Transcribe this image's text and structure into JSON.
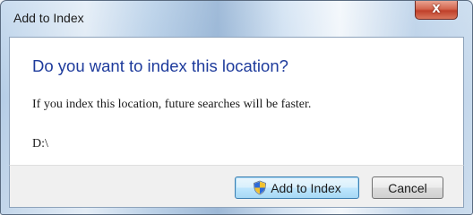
{
  "window": {
    "title": "Add to Index",
    "close_glyph": "X"
  },
  "dialog": {
    "heading": "Do you want to index this location?",
    "message": "If you index this location, future searches will be faster.",
    "location": "D:\\"
  },
  "buttons": {
    "primary_label": "Add to Index",
    "primary_icon": "uac-shield-icon",
    "cancel_label": "Cancel"
  },
  "colors": {
    "heading": "#1e3b9c",
    "close_button": "#c0402a"
  }
}
